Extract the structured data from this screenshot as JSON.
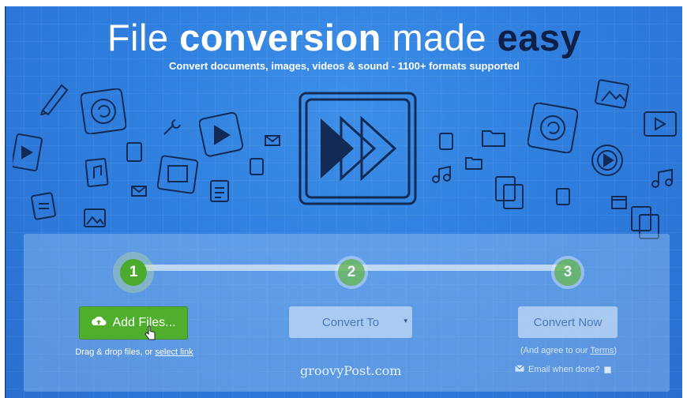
{
  "hero": {
    "title_part1": "File",
    "title_part2": "conversion",
    "title_part3": "made",
    "title_part4": "easy",
    "subtitle": "Convert documents, images, videos & sound - 1100+ formats supported"
  },
  "steps": [
    {
      "number": "1",
      "state": "active"
    },
    {
      "number": "2",
      "state": "idle"
    },
    {
      "number": "3",
      "state": "idle"
    }
  ],
  "add_files": {
    "label": "Add Files...",
    "hint_prefix": "Drag & drop files, or",
    "hint_link": "select link"
  },
  "convert_to": {
    "label": "Convert To",
    "caret": "▾"
  },
  "convert_now": {
    "label": "Convert Now",
    "agree_prefix": "(And agree to our",
    "agree_link": "Terms",
    "agree_suffix": ")",
    "email_label": "Email when done?"
  },
  "watermark": "groovyPost.com",
  "colors": {
    "background": "#2f7fdf",
    "accent_green": "#4fae2c",
    "title_dark": "#0f1f45"
  }
}
